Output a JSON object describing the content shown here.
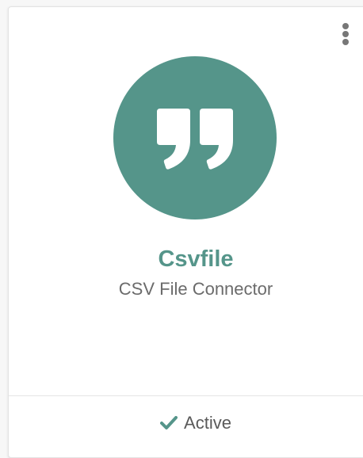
{
  "connector": {
    "name": "Csvfile",
    "description": "CSV File Connector",
    "status": "Active",
    "logo_icon": "quote-icon",
    "status_icon": "check-icon",
    "menu_icon": "kebab-menu-icon"
  },
  "colors": {
    "accent": "#55958a",
    "status_check": "#55958a",
    "text_muted": "#6b6b6b"
  }
}
